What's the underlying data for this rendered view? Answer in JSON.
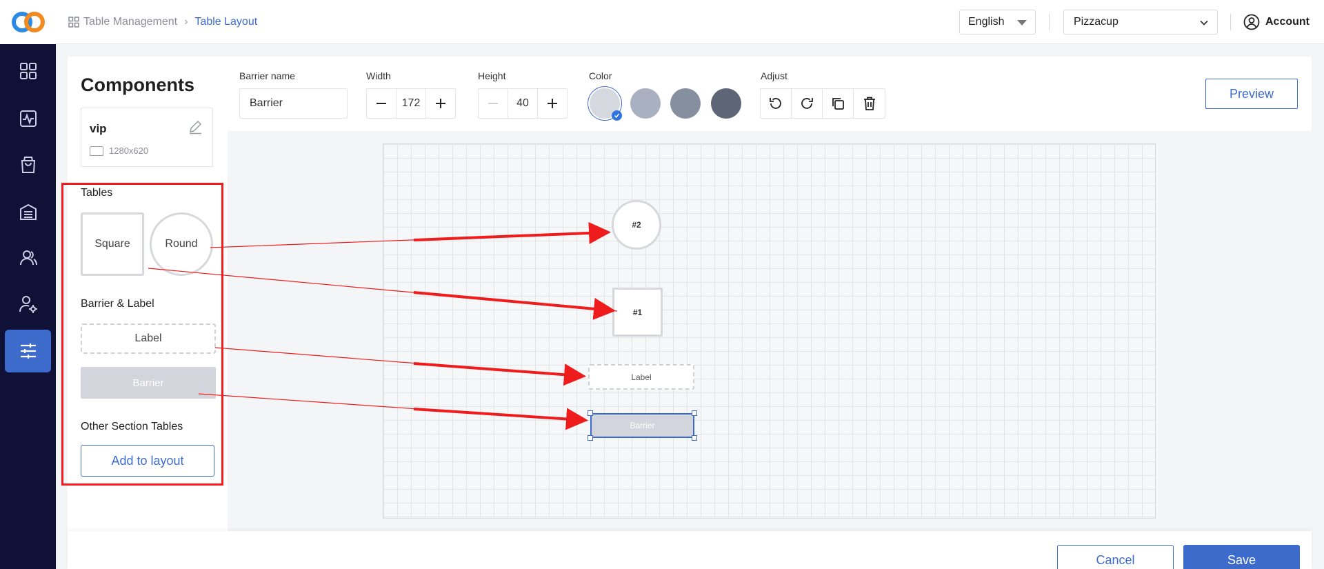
{
  "breadcrumb": {
    "parent": "Table Management",
    "current": "Table Layout"
  },
  "header": {
    "language": "English",
    "store": "Pizzacup",
    "account": "Account"
  },
  "panel": {
    "title": "Components",
    "section": {
      "name": "vip",
      "size": "1280x620"
    },
    "tables_heading": "Tables",
    "square": "Square",
    "round": "Round",
    "barrier_label_heading": "Barrier & Label",
    "label": "Label",
    "barrier": "Barrier",
    "other_heading": "Other Section Tables",
    "add_to_layout": "Add to layout"
  },
  "toolbar": {
    "barrier_name_label": "Barrier name",
    "barrier_name_value": "Barrier",
    "width_label": "Width",
    "width_value": "172",
    "height_label": "Height",
    "height_value": "40",
    "color_label": "Color",
    "adjust_label": "Adjust",
    "preview": "Preview",
    "colors": [
      "#d5d8de",
      "#a9b1c0",
      "#868fa0",
      "#5d6577"
    ]
  },
  "canvas": {
    "round_table": "#2",
    "square_table": "#1",
    "label": "Label",
    "barrier": "Barrier"
  },
  "footer": {
    "cancel": "Cancel",
    "save": "Save"
  }
}
